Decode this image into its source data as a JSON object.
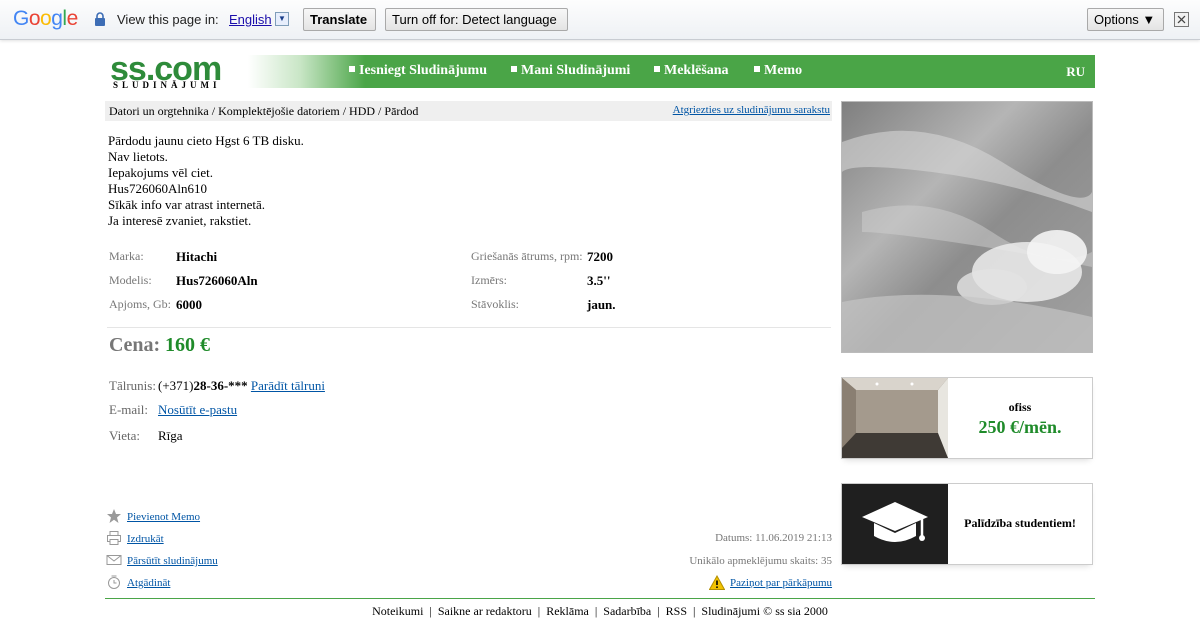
{
  "translate_bar": {
    "logo_letters": [
      "G",
      "o",
      "o",
      "g",
      "l",
      "e"
    ],
    "logo_colors": [
      "#4285f4",
      "#ea4335",
      "#fbbc05",
      "#4285f4",
      "#34a853",
      "#ea4335"
    ],
    "view_text": "View this page in:",
    "language": "English",
    "translate_label": "Translate",
    "turn_off_label": "Turn off for: Detect language",
    "options_label": "Options ▼"
  },
  "header": {
    "logo": "ss.com",
    "logo_sub": "SLUDINĀJUMI",
    "nav": [
      "Iesniegt Sludinājumu",
      "Mani Sludinājumi",
      "Meklēšana",
      "Memo"
    ],
    "lang": "RU",
    "accent_color": "#4aa547"
  },
  "breadcrumb": {
    "path": "Datori un orgtehnika / Komplektējošie datoriem / HDD / Pārdod",
    "back_link": "Atgriezties uz sludinājumu sarakstu"
  },
  "description": [
    "Pārdodu jaunu cieto Hgst 6 TB disku.",
    "Nav lietots.",
    "Iepakojums vēl ciet.",
    "Hus726060Aln610",
    "Sīkāk info var atrast internetā.",
    "Ja interesē zvaniet, rakstiet."
  ],
  "options": {
    "left": [
      {
        "label": "Marka:",
        "value": "Hitachi"
      },
      {
        "label": "Modelis:",
        "value": "Hus726060Aln"
      },
      {
        "label": "Apjoms, Gb:",
        "value": "6000"
      }
    ],
    "right": [
      {
        "label": "Griešanās ātrums, rpm:",
        "value": "7200"
      },
      {
        "label": "Izmērs:",
        "value": "3.5''"
      },
      {
        "label": "Stāvoklis:",
        "value": "jaun."
      }
    ]
  },
  "price": {
    "label": "Cena:",
    "value": "160 €"
  },
  "contact": {
    "phone_label": "Tālrunis:",
    "phone_prefix": "(+371)",
    "phone_masked": "28-36-***",
    "phone_link": "Parādīt tālruni",
    "email_label": "E-mail:",
    "email_link": "Nosūtīt e-pastu",
    "place_label": "Vieta:",
    "place_value": "Rīga"
  },
  "actions": [
    {
      "icon": "star-icon",
      "label": "Pievienot Memo"
    },
    {
      "icon": "printer-icon",
      "label": "Izdrukāt"
    },
    {
      "icon": "envelope-icon",
      "label": "Pārsūtīt sludinājumu"
    },
    {
      "icon": "alarm-clock-icon",
      "label": "Atgādināt"
    }
  ],
  "meta": {
    "date": "Datums: 11.06.2019 21:13",
    "views": "Unikālo apmeklējumu skaits: 35",
    "report": "Paziņot par pārkāpumu"
  },
  "footer": [
    "Noteikumi",
    "Saikne ar redaktoru",
    "Reklāma",
    "Sadarbība",
    "RSS",
    "Sludinājumi © ss sia 2000"
  ],
  "ads": [
    {
      "title": "ofiss",
      "price": "250 €/mēn."
    },
    {
      "title": "Palīdzība studentiem!"
    }
  ]
}
